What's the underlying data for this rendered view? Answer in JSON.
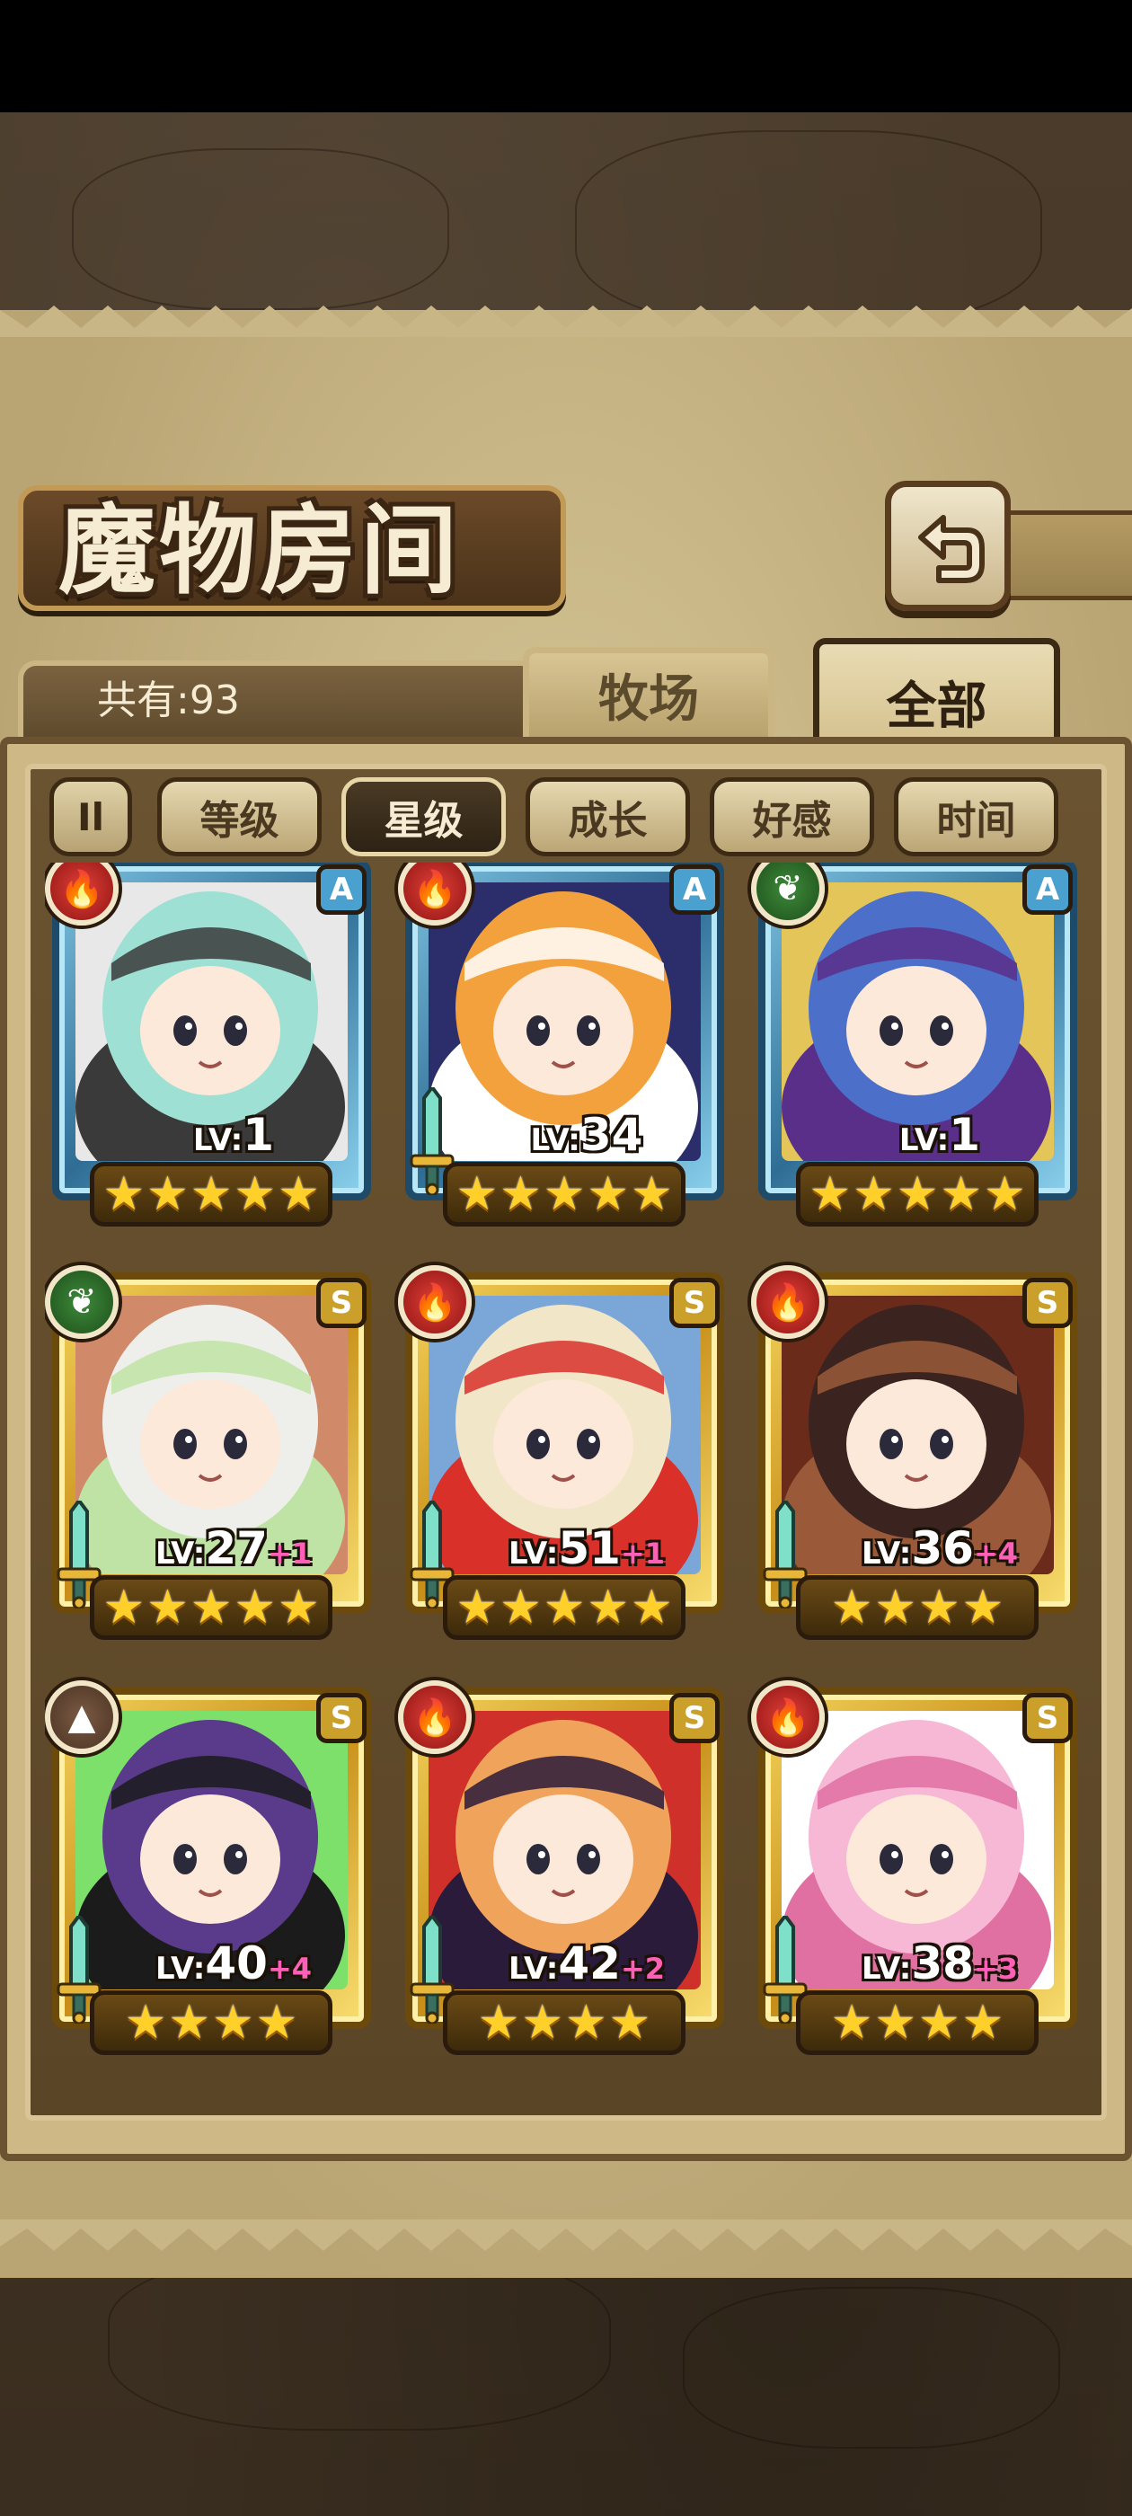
{
  "header": {
    "title": "魔物房间",
    "back_icon": "return-arrow-icon"
  },
  "inventory": {
    "count_label": "共有:93"
  },
  "tabs": [
    {
      "label": "牧场",
      "active": false
    },
    {
      "label": "全部",
      "active": true
    }
  ],
  "sort": {
    "toggle_label": "Il",
    "buttons": [
      {
        "label": "等级",
        "active": false
      },
      {
        "label": "星级",
        "active": true
      },
      {
        "label": "成长",
        "active": false
      },
      {
        "label": "好感",
        "active": false
      },
      {
        "label": "时间",
        "active": false
      }
    ]
  },
  "monsters": [
    {
      "element": "fire",
      "rank": "A",
      "level_prefix": "LV:",
      "level": "1",
      "bonus": "",
      "stars": 5,
      "sword": false,
      "palette": [
        "#9fe0d4",
        "#3a3a3a",
        "#e8e8e8"
      ]
    },
    {
      "element": "fire",
      "rank": "A",
      "level_prefix": "LV:",
      "level": "34",
      "bonus": "",
      "stars": 5,
      "sword": true,
      "palette": [
        "#f3a13c",
        "#ffffff",
        "#2b2e6b"
      ]
    },
    {
      "element": "leaf",
      "rank": "A",
      "level_prefix": "LV:",
      "level": "1",
      "bonus": "",
      "stars": 5,
      "sword": false,
      "palette": [
        "#4c6fc9",
        "#5a2f8a",
        "#e4c55a"
      ]
    },
    {
      "element": "leaf",
      "rank": "S",
      "level_prefix": "LV:",
      "level": "27",
      "bonus": "+1",
      "stars": 5,
      "sword": true,
      "palette": [
        "#eeeeea",
        "#bfe3a5",
        "#d08a6a"
      ]
    },
    {
      "element": "fire",
      "rank": "S",
      "level_prefix": "LV:",
      "level": "51",
      "bonus": "+1",
      "stars": 5,
      "sword": true,
      "palette": [
        "#f1e6c8",
        "#d9302a",
        "#7aa7d8"
      ]
    },
    {
      "element": "fire",
      "rank": "S",
      "level_prefix": "LV:",
      "level": "36",
      "bonus": "+4",
      "stars": 4,
      "sword": true,
      "palette": [
        "#3b2320",
        "#9a5a3a",
        "#6a2b1a"
      ]
    },
    {
      "element": "earth",
      "rank": "S",
      "level_prefix": "LV:",
      "level": "40",
      "bonus": "+4",
      "stars": 4,
      "sword": true,
      "palette": [
        "#5a3a8a",
        "#1b1b1b",
        "#7de06a"
      ]
    },
    {
      "element": "fire",
      "rank": "S",
      "level_prefix": "LV:",
      "level": "42",
      "bonus": "+2",
      "stars": 4,
      "sword": true,
      "palette": [
        "#f0a35a",
        "#2a1b3b",
        "#d0302a"
      ]
    },
    {
      "element": "fire",
      "rank": "S",
      "level_prefix": "LV:",
      "level": "38",
      "bonus": "+3",
      "stars": 4,
      "sword": true,
      "palette": [
        "#f6b8d4",
        "#e06fa2",
        "#ffffff"
      ]
    }
  ],
  "colors": {
    "rank_a_frame": "#2f6d95",
    "rank_s_frame": "#c78e18",
    "star": "#ffcf2a",
    "bonus": "#ff5fb6"
  }
}
